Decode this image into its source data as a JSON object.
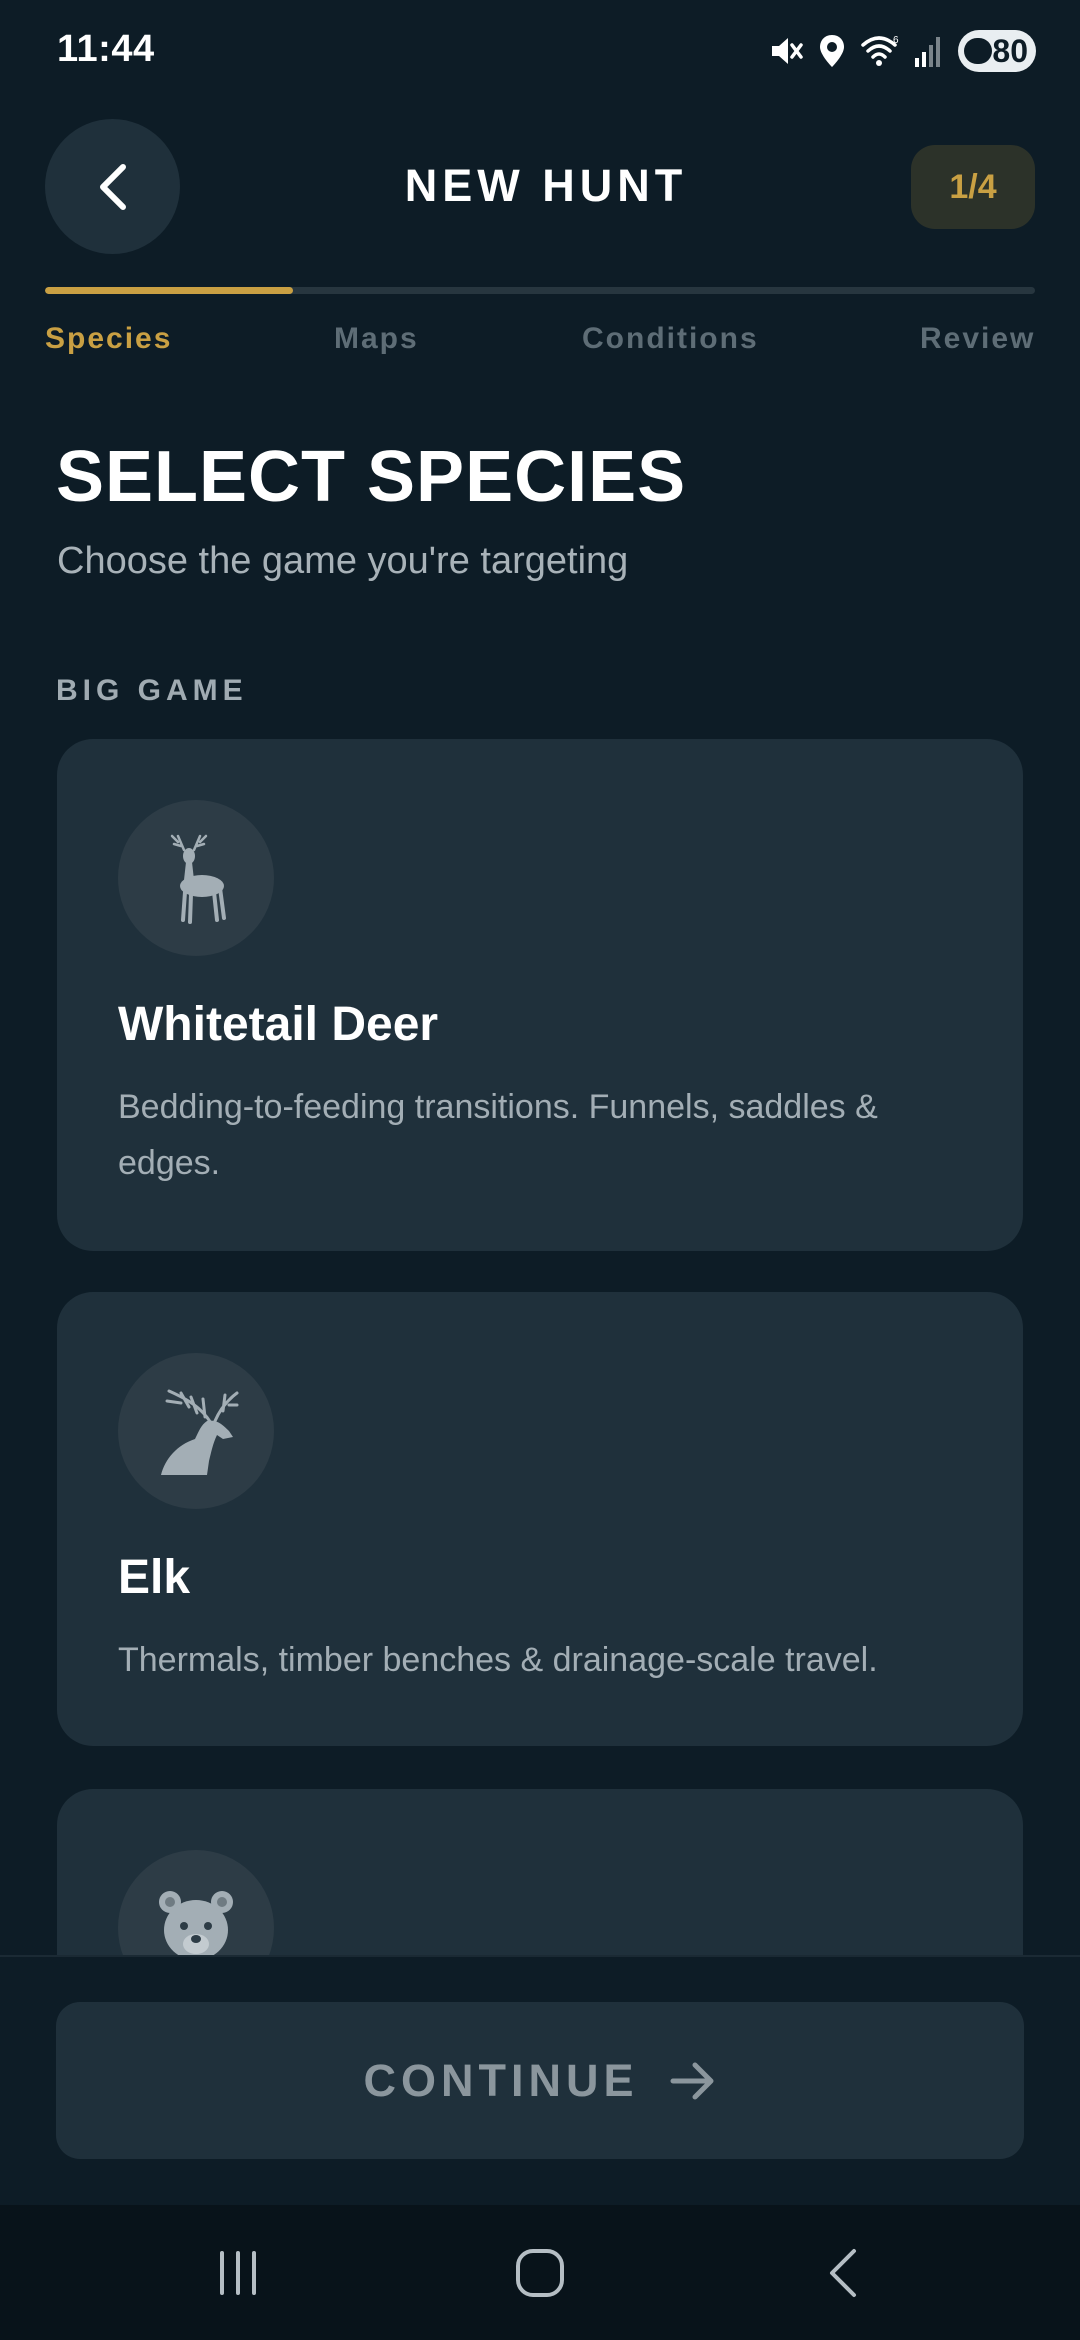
{
  "status_bar": {
    "time": "11:44",
    "battery": "80",
    "icons": [
      "mute-icon",
      "location-icon",
      "wifi-icon",
      "signal-icon",
      "battery-icon"
    ]
  },
  "header": {
    "title": "NEW HUNT",
    "step_badge": "1/4"
  },
  "progress": {
    "fraction": 0.25,
    "steps": [
      {
        "label": "Species",
        "active": true
      },
      {
        "label": "Maps",
        "active": false
      },
      {
        "label": "Conditions",
        "active": false
      },
      {
        "label": "Review",
        "active": false
      }
    ]
  },
  "main": {
    "title": "SELECT SPECIES",
    "subtitle": "Choose the game you're targeting",
    "section_label": "BIG GAME",
    "species": [
      {
        "icon": "deer-icon",
        "name": "Whitetail Deer",
        "description": "Bedding-to-feeding transitions. Funnels, saddles & edges."
      },
      {
        "icon": "elk-icon",
        "name": "Elk",
        "description": "Thermals, timber benches & drainage-scale travel."
      },
      {
        "icon": "bear-icon"
      }
    ]
  },
  "footer": {
    "continue_label": "CONTINUE",
    "continue_icon": "arrow-right-icon"
  },
  "nav": {
    "icons": [
      "recents-icon",
      "home-icon",
      "back-icon"
    ]
  },
  "colors": {
    "background": "#0d1c26",
    "card": "#1f303b",
    "accent": "#c9a043",
    "muted": "#5e6d76"
  }
}
